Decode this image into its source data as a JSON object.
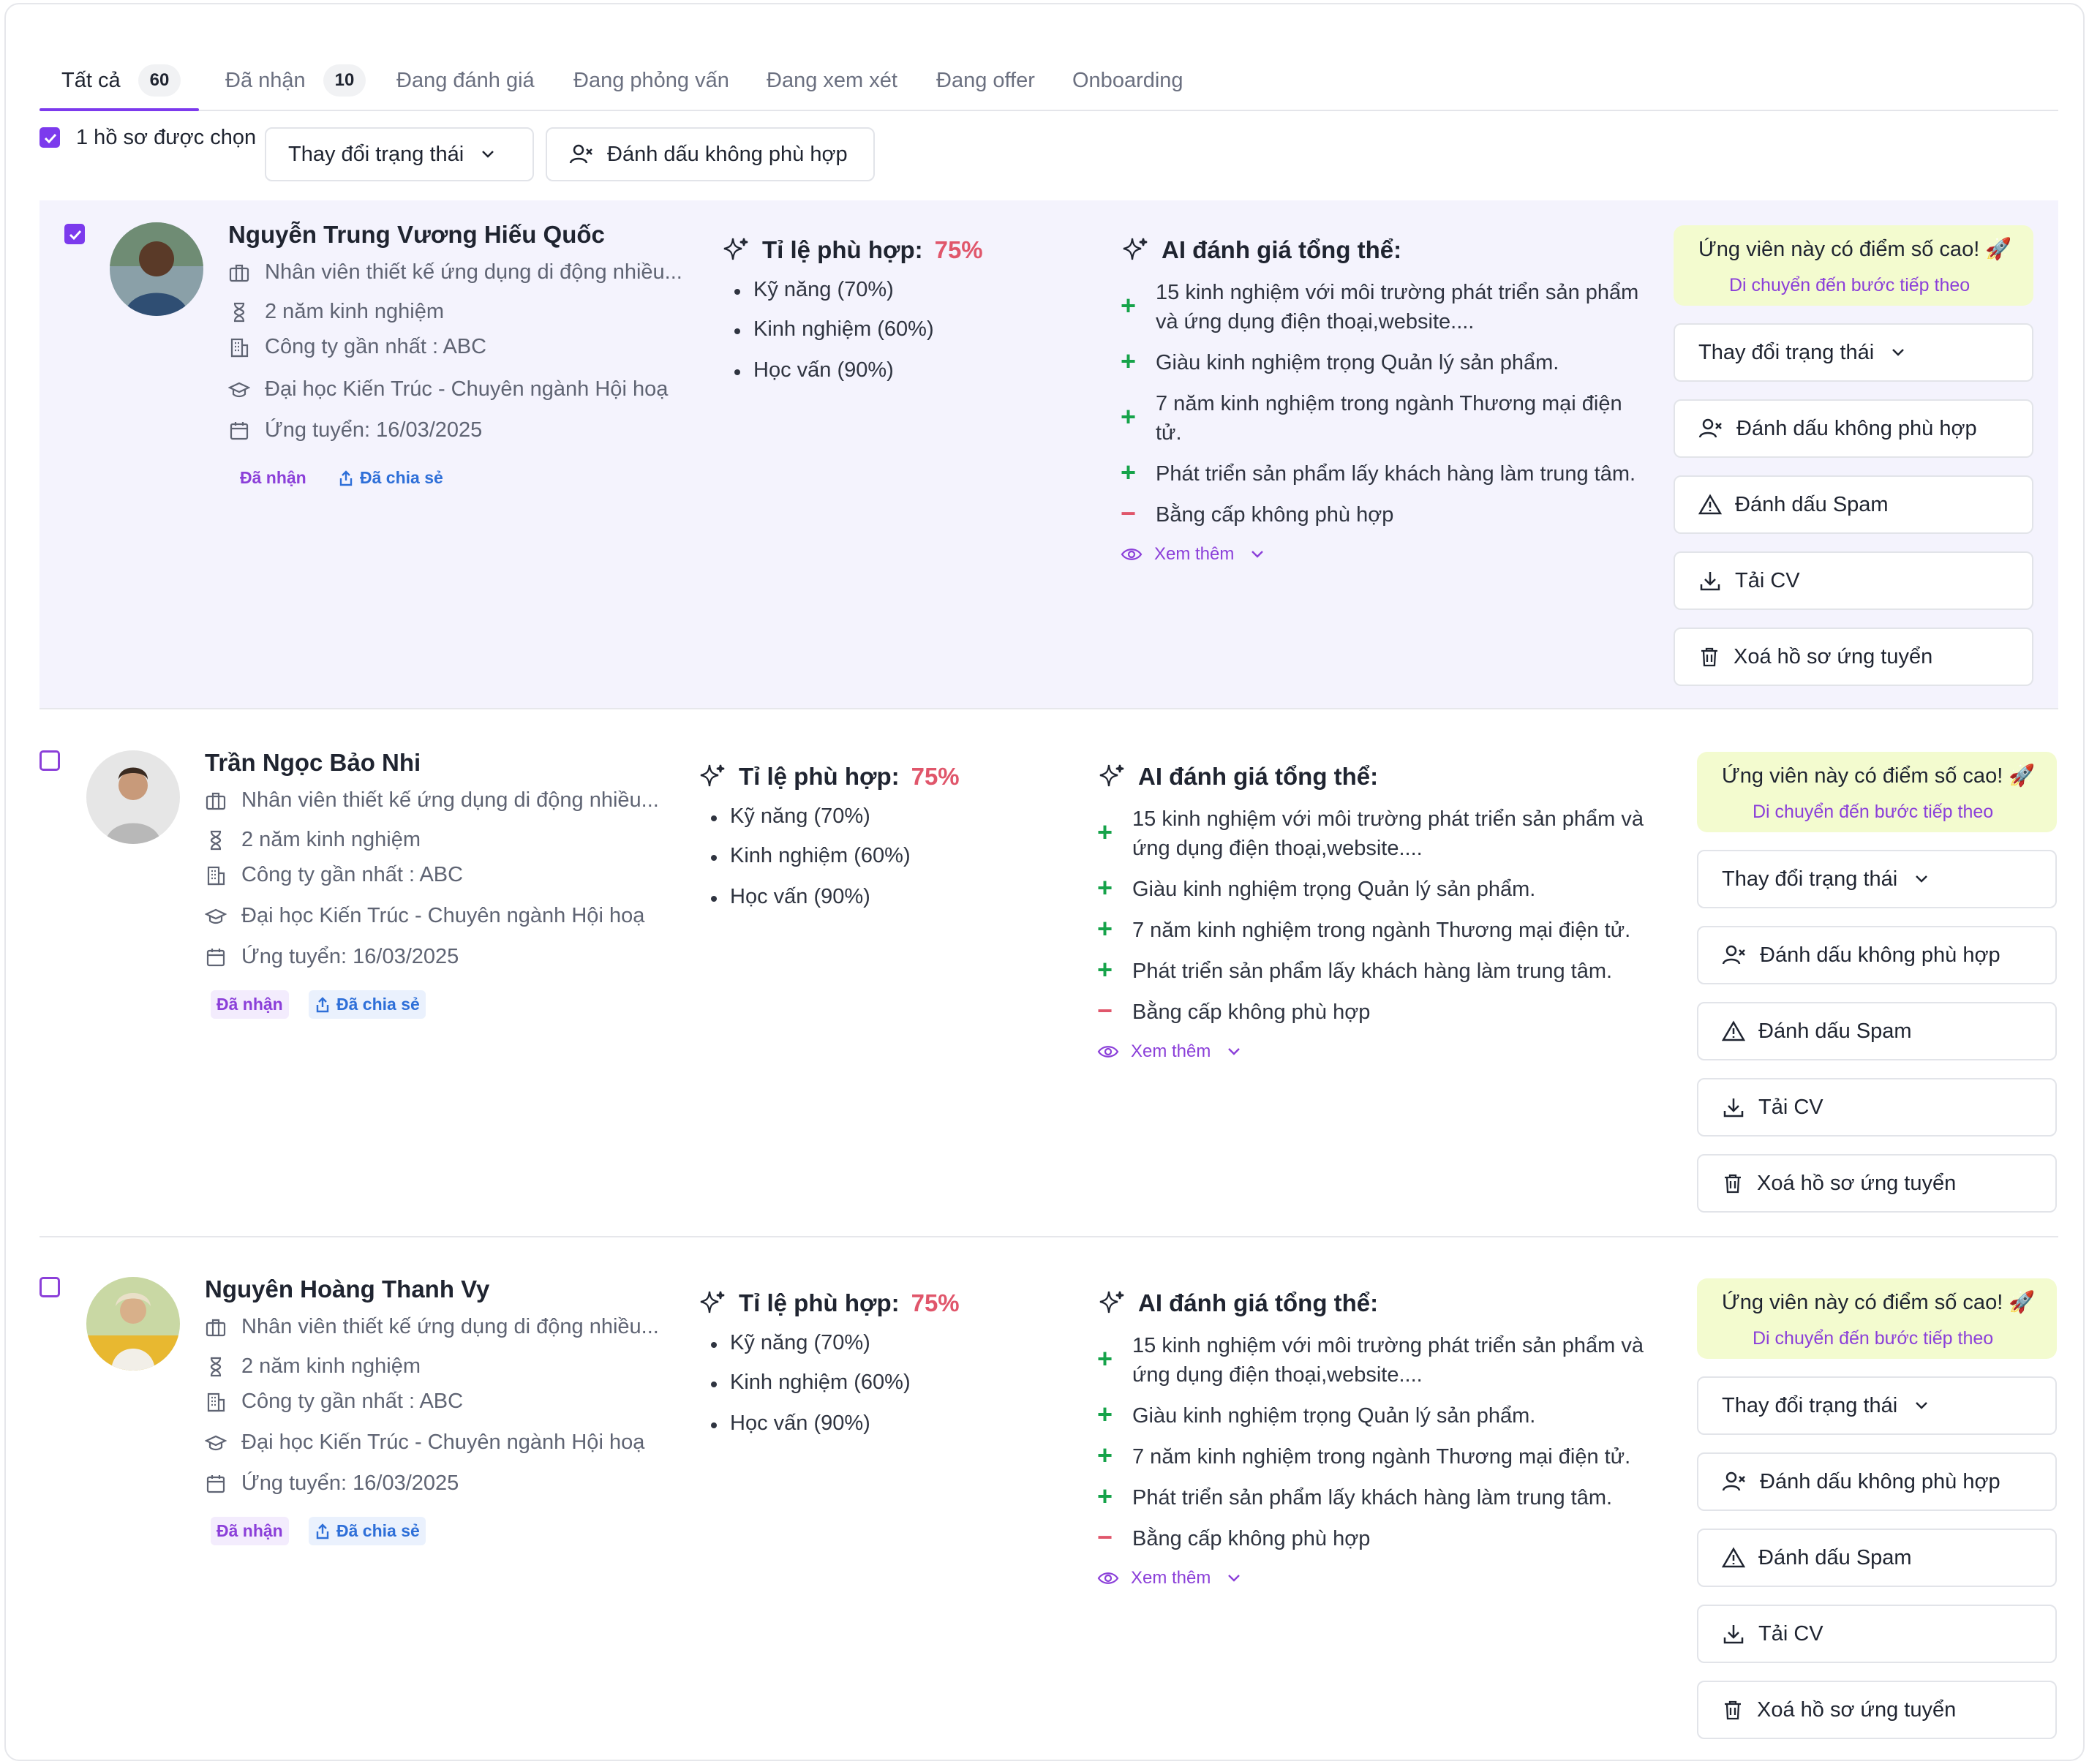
{
  "tabs": [
    {
      "label": "Tất cả",
      "count": "60"
    },
    {
      "label": "Đã nhận",
      "count": "10"
    },
    {
      "label": "Đang đánh giá"
    },
    {
      "label": "Đang phỏng vấn"
    },
    {
      "label": "Đang xem xét"
    },
    {
      "label": "Đang offer"
    },
    {
      "label": "Onboarding"
    }
  ],
  "bulk": {
    "selected_text": "1 hồ sơ được chọn",
    "change_status_label": "Thay đổi trạng thái",
    "mark_unfit_label": "Đánh dấu không phù hợp"
  },
  "candidates": [
    {
      "selected": true,
      "name": "Nguyễn Trung Vương Hiếu Quốc",
      "position": "Nhân viên thiết kế ứng dụng di động nhiều...",
      "experience": "2 năm kinh nghiệm",
      "company": "Công ty gần nhất : ABC",
      "education": "Đại học Kiến Trúc - Chuyên ngành Hội hoạ",
      "applied": "Ứng tuyển: 16/03/2025",
      "tag_received": "Đã nhận",
      "tag_shared": "Đã chia sẻ",
      "match_title": "Tỉ lệ phù hợp:",
      "match_percent": "75%",
      "match_items": [
        "Kỹ năng (70%)",
        "Kinh nghiệm (60%)",
        "Học vấn (90%)"
      ],
      "ai_title": "AI đánh giá tổng thể:",
      "ai_items": [
        {
          "sign": "+",
          "text": "15 kinh nghiệm với môi trường phát triển sản phẩm và ứng dụng điện thoại,website...."
        },
        {
          "sign": "+",
          "text": "Giàu kinh nghiệm trọng Quản lý sản phẩm."
        },
        {
          "sign": "+",
          "text": "7 năm kinh nghiệm trong ngành Thương mại điện tử."
        },
        {
          "sign": "+",
          "text": "Phát triển sản phẩm lấy khách hàng làm trung tâm."
        },
        {
          "sign": "−",
          "text": "Bằng cấp không phù hợp"
        }
      ],
      "see_more": "Xem thêm",
      "highlight_title": "Ứng viên này có điểm số cao! 🚀",
      "highlight_link": "Di chuyển đến bước tiếp theo",
      "actions": [
        "Thay đổi trạng thái",
        "Đánh dấu không phù hợp",
        "Đánh dấu Spam",
        "Tải CV",
        "Xoá hồ sơ ứng tuyển"
      ]
    },
    {
      "selected": false,
      "name": "Trần Ngọc Bảo Nhi",
      "position": "Nhân viên thiết kế ứng dụng di động nhiều...",
      "experience": "2 năm kinh nghiệm",
      "company": "Công ty gần nhất : ABC",
      "education": "Đại học Kiến Trúc - Chuyên ngành Hội hoạ",
      "applied": "Ứng tuyển: 16/03/2025",
      "tag_received": "Đã nhận",
      "tag_shared": "Đã chia sẻ",
      "match_title": "Tỉ lệ phù hợp:",
      "match_percent": "75%",
      "match_items": [
        "Kỹ năng (70%)",
        "Kinh nghiệm (60%)",
        "Học vấn (90%)"
      ],
      "ai_title": "AI đánh giá tổng thể:",
      "ai_items": [
        {
          "sign": "+",
          "text": "15 kinh nghiệm với môi trường phát triển sản phẩm và ứng dụng điện thoại,website...."
        },
        {
          "sign": "+",
          "text": "Giàu kinh nghiệm trọng Quản lý sản phẩm."
        },
        {
          "sign": "+",
          "text": "7 năm kinh nghiệm trong ngành Thương mại điện tử."
        },
        {
          "sign": "+",
          "text": "Phát triển sản phẩm lấy khách hàng làm trung tâm."
        },
        {
          "sign": "−",
          "text": "Bằng cấp không phù hợp"
        }
      ],
      "see_more": "Xem thêm",
      "highlight_title": "Ứng viên này có điểm số cao! 🚀",
      "highlight_link": "Di chuyển đến bước tiếp theo",
      "actions": [
        "Thay đổi trạng thái",
        "Đánh dấu không phù hợp",
        "Đánh dấu Spam",
        "Tải CV",
        "Xoá hồ sơ ứng tuyển"
      ]
    },
    {
      "selected": false,
      "name": "Nguyên Hoàng Thanh Vy",
      "position": "Nhân viên thiết kế ứng dụng di động nhiều...",
      "experience": "2 năm kinh nghiệm",
      "company": "Công ty gần nhất : ABC",
      "education": "Đại học Kiến Trúc - Chuyên ngành Hội hoạ",
      "applied": "Ứng tuyển: 16/03/2025",
      "tag_received": "Đã nhận",
      "tag_shared": "Đã chia sẻ",
      "match_title": "Tỉ lệ phù hợp:",
      "match_percent": "75%",
      "match_items": [
        "Kỹ năng (70%)",
        "Kinh nghiệm (60%)",
        "Học vấn (90%)"
      ],
      "ai_title": "AI đánh giá tổng thể:",
      "ai_items": [
        {
          "sign": "+",
          "text": "15 kinh nghiệm với môi trường phát triển sản phẩm và ứng dụng điện thoại,website...."
        },
        {
          "sign": "+",
          "text": "Giàu kinh nghiệm trọng Quản lý sản phẩm."
        },
        {
          "sign": "+",
          "text": "7 năm kinh nghiệm trong ngành Thương mại điện tử."
        },
        {
          "sign": "+",
          "text": "Phát triển sản phẩm lấy khách hàng làm trung tâm."
        },
        {
          "sign": "−",
          "text": "Bằng cấp không phù hợp"
        }
      ],
      "see_more": "Xem thêm",
      "highlight_title": "Ứng viên này có điểm số cao! 🚀",
      "highlight_link": "Di chuyển đến bước tiếp theo",
      "actions": [
        "Thay đổi trạng thái",
        "Đánh dấu không phù hợp",
        "Đánh dấu Spam",
        "Tải CV",
        "Xoá hồ sơ ứng tuyển"
      ]
    }
  ],
  "colors": {
    "accent": "#7c3aed",
    "percent": "#e0566b",
    "positive": "#16a34a",
    "negative": "#e0566b",
    "highlight_bg": "#f3fbcf",
    "selected_row_bg": "#f4f3fd"
  }
}
